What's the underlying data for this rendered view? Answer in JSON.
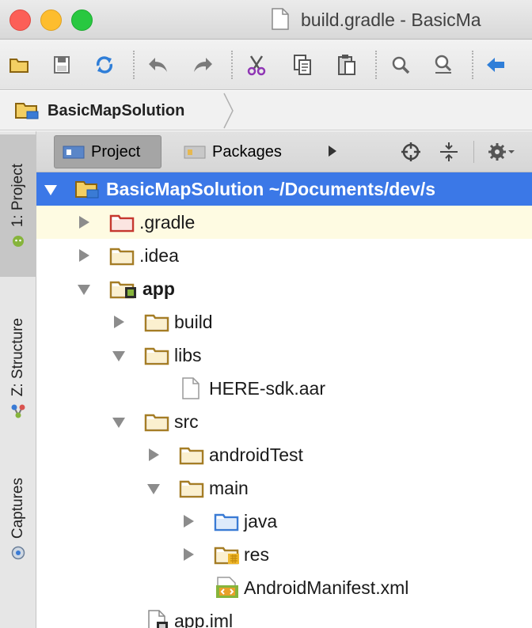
{
  "window": {
    "title": "build.gradle - BasicMa"
  },
  "toolbar": {
    "buttons": [
      {
        "name": "open-folder-icon"
      },
      {
        "name": "save-icon"
      },
      {
        "name": "sync-icon"
      },
      {
        "name": "undo-icon"
      },
      {
        "name": "redo-icon"
      },
      {
        "name": "cut-icon"
      },
      {
        "name": "copy-icon"
      },
      {
        "name": "paste-icon"
      },
      {
        "name": "find-icon"
      },
      {
        "name": "replace-icon"
      },
      {
        "name": "back-icon"
      }
    ]
  },
  "breadcrumb": {
    "project": "BasicMapSolution"
  },
  "sidebar": {
    "tabs": [
      {
        "label": "1: Project"
      },
      {
        "label": "Z: Structure"
      },
      {
        "label": "Captures"
      }
    ]
  },
  "panel": {
    "tabs": [
      {
        "label": "Project"
      },
      {
        "label": "Packages"
      }
    ]
  },
  "tree": {
    "root": {
      "label": "BasicMapSolution",
      "path": "~/Documents/dev/s"
    },
    "items": [
      {
        "label": ".gradle"
      },
      {
        "label": ".idea"
      },
      {
        "label": "app"
      },
      {
        "label": "build"
      },
      {
        "label": "libs"
      },
      {
        "label": "HERE-sdk.aar"
      },
      {
        "label": "src"
      },
      {
        "label": "androidTest"
      },
      {
        "label": "main"
      },
      {
        "label": "java"
      },
      {
        "label": "res"
      },
      {
        "label": "AndroidManifest.xml"
      },
      {
        "label": "app.iml"
      }
    ]
  },
  "colors": {
    "selection": "#3b78e7",
    "hover_row": "#fefbe2",
    "folder": "#a57d25"
  }
}
